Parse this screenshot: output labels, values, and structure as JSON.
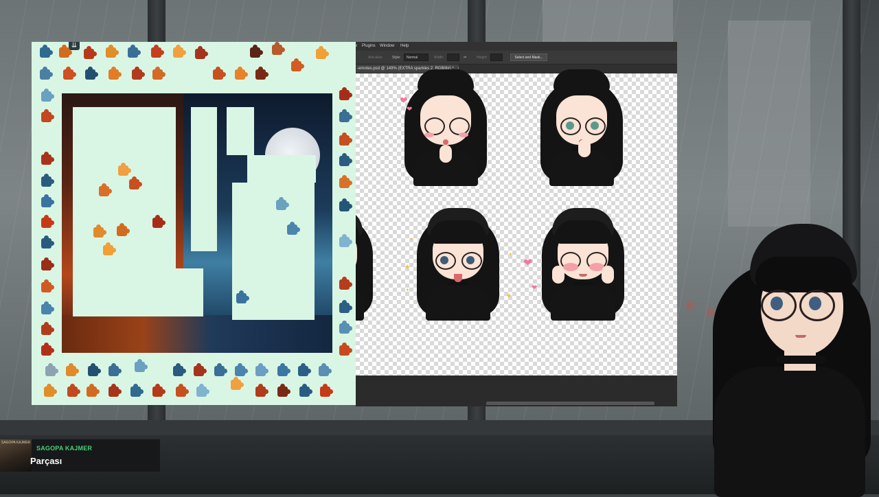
{
  "puzzle": {
    "collapse_icon": "double-chevron-down"
  },
  "photoshop": {
    "menu": [
      "Plugins",
      "Window",
      "Help"
    ],
    "options": {
      "antialias_label": "Anti-alias",
      "style_label": "Style:",
      "style_value": "Normal",
      "width_label": "Width:",
      "height_label": "Height:",
      "select_mask_button": "Select and Mask..."
    },
    "document_tab": "-emotes.psd @ 149% (EXTRA sparkles 2, RGB/8#) *"
  },
  "now_playing": {
    "art_label": "SAGOPA KAJMER",
    "artist": "SAGOPA KAJMER",
    "title": "Parçası"
  },
  "colors": {
    "puzzle_bg": "#d9f6e5",
    "artist_green": "#4ad07c",
    "ps_dark": "#2b2b2b"
  }
}
